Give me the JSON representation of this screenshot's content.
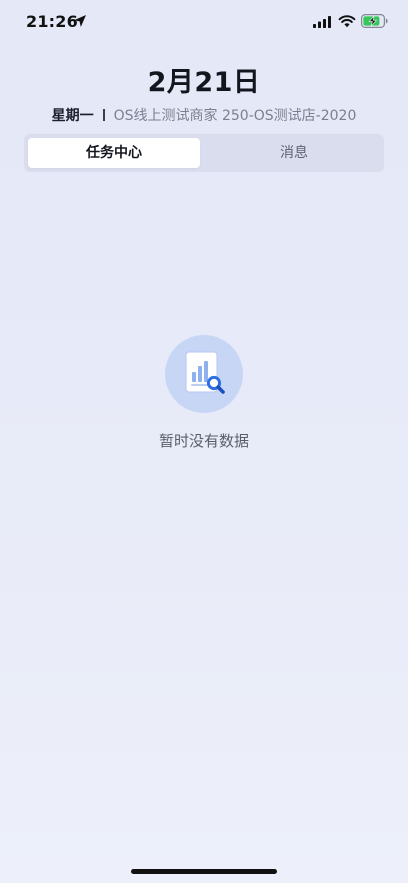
{
  "status_bar": {
    "time": "21:26",
    "icons": [
      "location-arrow-icon",
      "cellular-signal-icon",
      "wifi-icon",
      "battery-charging-icon"
    ]
  },
  "header": {
    "date": "2月21日",
    "weekday": "星期一",
    "store": "OS线上测试商家 250-OS测试店-2020"
  },
  "tabs": [
    {
      "label": "任务中心",
      "active": true
    },
    {
      "label": "消息",
      "active": false
    }
  ],
  "empty_state": {
    "icon": "document-chart-search-icon",
    "message": "暂时没有数据"
  },
  "colors": {
    "background": "#e6e9f7",
    "tab_bar_bg": "#d9dded",
    "tab_active_bg": "#ffffff",
    "empty_icon_circle": "#c8d6f6",
    "accent_blue": "#2f6fe4",
    "battery_green": "#34c759"
  }
}
